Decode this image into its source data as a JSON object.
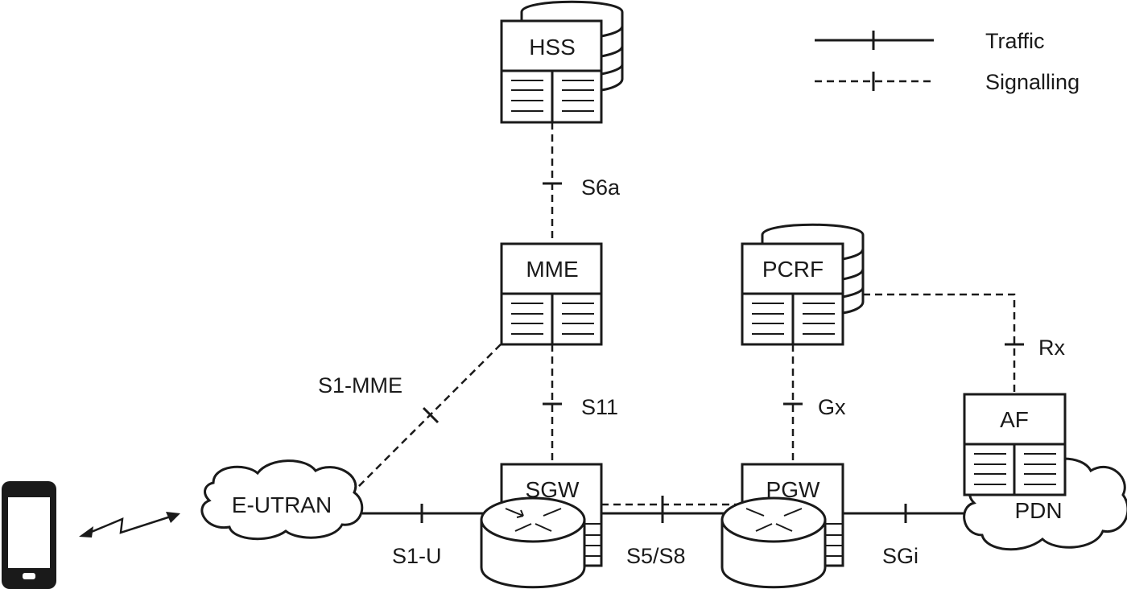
{
  "legend": {
    "traffic": "Traffic",
    "signalling": "Signalling"
  },
  "nodes": {
    "hss": "HSS",
    "mme": "MME",
    "pcrf": "PCRF",
    "af": "AF",
    "sgw": "SGW",
    "pgw": "PGW",
    "eutran": "E-UTRAN",
    "pdn": "PDN"
  },
  "interfaces": {
    "s6a": "S6a",
    "s11": "S11",
    "s1_mme": "S1-MME",
    "gx": "Gx",
    "rx": "Rx",
    "s1_u": "S1-U",
    "s5_s8": "S5/S8",
    "sgi": "SGi"
  },
  "colors": {
    "ink": "#1a1a1a",
    "background": "#ffffff"
  }
}
